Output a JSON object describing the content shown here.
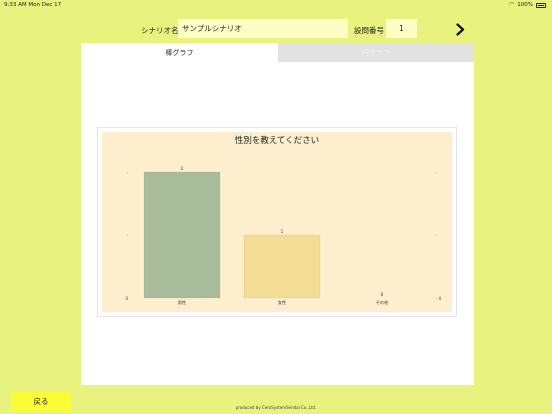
{
  "status_bar": {
    "time": "9:33 AM",
    "date": "Mon Dec 17",
    "battery": "100%"
  },
  "form": {
    "scenario_label": "シナリオ名",
    "scenario_value": "サンプルシナリオ",
    "question_label": "設問番号",
    "question_value": "1"
  },
  "tabs": [
    {
      "label": "棒グラフ",
      "active": true
    },
    {
      "label": "円グラフ",
      "active": false
    }
  ],
  "icons": {
    "next": "chevron-right-icon",
    "wifi": "wifi-icon",
    "battery": "battery-icon"
  },
  "colors": {
    "background": "#e8f27e",
    "chart_background": "#fdefcd",
    "bar_male": "#a8bb9b",
    "bar_female": "#f3dc94",
    "back_button": "#fbfb37"
  },
  "chart_data": {
    "type": "bar",
    "title": "性別を教えてください",
    "categories": [
      "男性",
      "女性",
      "その他"
    ],
    "values": [
      2,
      1,
      0
    ],
    "value_labels": [
      "2",
      "1",
      "0"
    ],
    "ylim": [
      0,
      2
    ],
    "y_ticks": [
      {
        "value": 0,
        "label": "0"
      },
      {
        "value": 1,
        "label": "-"
      },
      {
        "value": 2,
        "label": "-"
      }
    ],
    "grid": false
  },
  "footer": {
    "back_label": "戻る",
    "credit": "produced by CeroSystemSendai Co.,Ltd."
  }
}
